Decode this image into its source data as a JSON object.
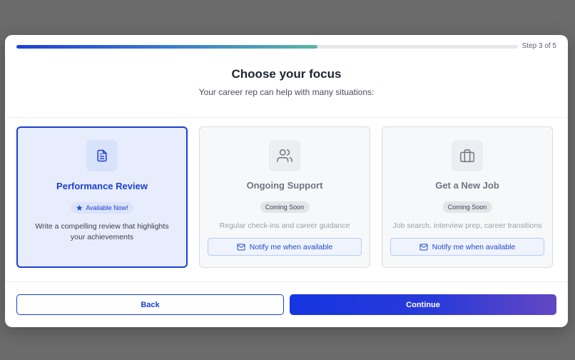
{
  "progress": {
    "value": 0.6,
    "step_label": "Step 3 of 5"
  },
  "header": {
    "title": "Choose your focus",
    "subtitle": "Your career rep can help with many situations:"
  },
  "cards": [
    {
      "title": "Performance Review",
      "icon": "document-icon",
      "badge": "Available Now!",
      "badge_icon": "star-icon",
      "description": "Write a compelling review that highlights your achievements",
      "selected": true
    },
    {
      "title": "Ongoing Support",
      "icon": "users-icon",
      "badge": "Coming Soon",
      "description": "Regular check-ins and career guidance",
      "notify_label": "Notify me when available",
      "selected": false
    },
    {
      "title": "Get a New Job",
      "icon": "briefcase-icon",
      "badge": "Coming Soon",
      "description": "Job search, interview prep, career transitions",
      "notify_label": "Notify me when available",
      "selected": false
    }
  ],
  "footer": {
    "back_label": "Back",
    "continue_label": "Continue"
  },
  "colors": {
    "accent": "#1a3fd0",
    "overlay": "#6b6b6b",
    "selected_card_bg": "#e8edfd"
  }
}
